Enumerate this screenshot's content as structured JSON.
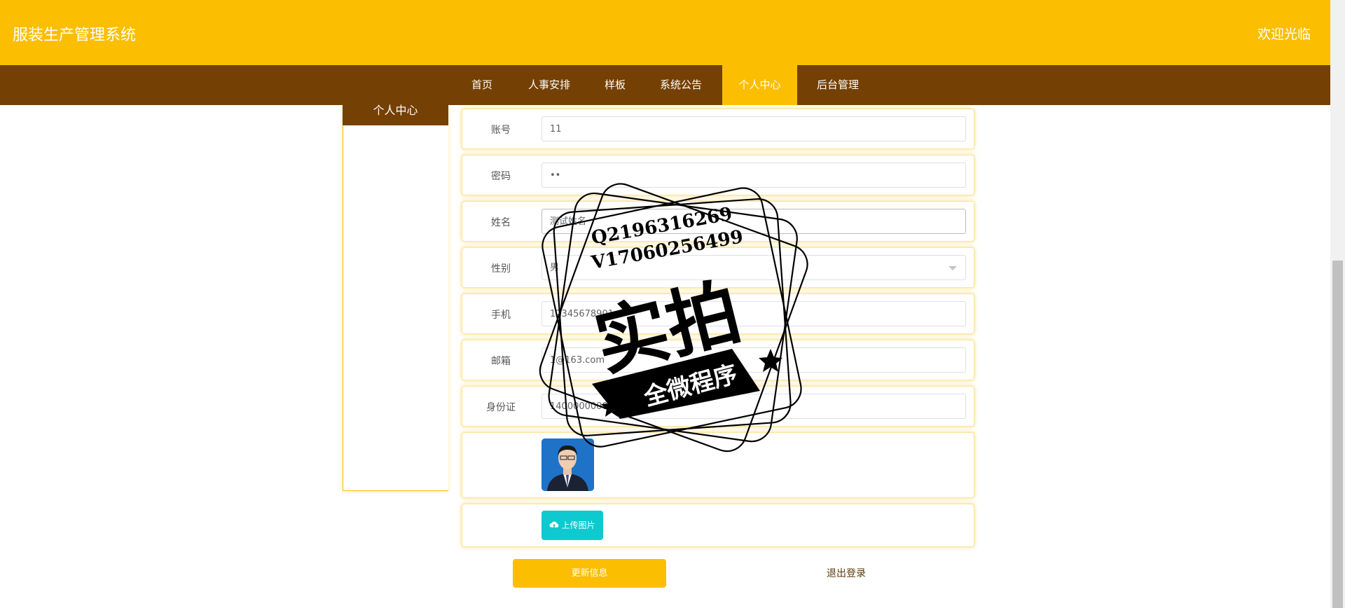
{
  "header": {
    "app_title": "服装生产管理系统",
    "welcome_text": "欢迎光临"
  },
  "nav": {
    "items": [
      "首页",
      "人事安排",
      "样板",
      "系统公告",
      "个人中心",
      "后台管理"
    ],
    "active": "个人中心"
  },
  "sidebar": {
    "title": "个人中心"
  },
  "form": {
    "account": {
      "label": "账号",
      "value": "11"
    },
    "password": {
      "label": "密码",
      "value": "••"
    },
    "name": {
      "label": "姓名",
      "value": "测试姓名"
    },
    "gender": {
      "label": "性别",
      "value": "男"
    },
    "phone": {
      "label": "手机",
      "value": "12345678901"
    },
    "email": {
      "label": "邮箱",
      "value": "1@163.com"
    },
    "id_card": {
      "label": "身份证",
      "value": "140000000000000000"
    },
    "photo": {
      "label": ""
    },
    "upload_label": "上传图片"
  },
  "actions": {
    "update_label": "更新信息",
    "logout_label": "退出登录"
  },
  "watermark": {
    "line1": "Q2196316269",
    "line2": "V17060256499",
    "big_text": "实拍",
    "banner_text": "全微程序"
  },
  "colors": {
    "primary": "#fbbe00",
    "nav_bg": "#744003",
    "upload_btn": "#0fc9d0"
  }
}
